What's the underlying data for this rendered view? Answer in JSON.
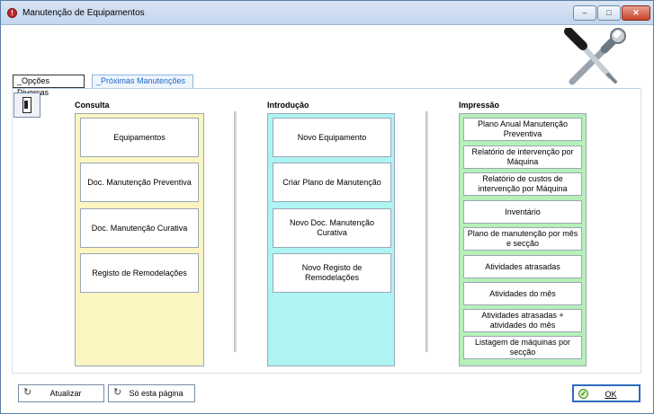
{
  "window": {
    "title": "Manutenção de Equipamentos",
    "controls": {
      "minimize": "–",
      "maximize": "□",
      "close": "✕"
    }
  },
  "tabs": [
    {
      "label": "_Opções Diversas",
      "active": false
    },
    {
      "label": "_Próximas Manutenções",
      "active": true
    }
  ],
  "sections": {
    "consulta": {
      "heading": "Consulta",
      "buttons": [
        "Equipamentos",
        "Doc. Manutenção Preventiva",
        "Doc. Manutenção Curativa",
        "Registo de Remodelações"
      ]
    },
    "introducao": {
      "heading": "Introdução",
      "buttons": [
        "Novo Equipamento",
        "Criar Plano de Manutenção",
        "Novo Doc. Manutenção Curativa",
        "Novo Registo de Remodelações"
      ]
    },
    "impressao": {
      "heading": "Impressão",
      "buttons": [
        "Plano Anual Manutenção Preventiva",
        "Relatório de intervenção por Máquina",
        "Relatório de custos de intervenção por Máquina",
        "Inventário",
        "Plano de manutenção por mês e secção",
        "Atividades atrasadas",
        "Atividades do mês",
        "Atividades atrasadas + atividades do mês",
        "Listagem de máquinas por secção"
      ]
    }
  },
  "footer": {
    "atualizar_label": "Atualizar",
    "so_esta_pagina_label": "Só esta página",
    "ok_label": "OK"
  },
  "colors": {
    "consulta_bg": "#fbf6c1",
    "introducao_bg": "#aef4f2",
    "impressao_bg": "#b6f0b8",
    "active_tab_text": "#1f66c3"
  },
  "icons": {
    "app": "app-icon",
    "tools": "wrench-screwdriver-icon",
    "door": "door-icon",
    "refresh": "refresh-icon",
    "ok": "check-icon"
  }
}
